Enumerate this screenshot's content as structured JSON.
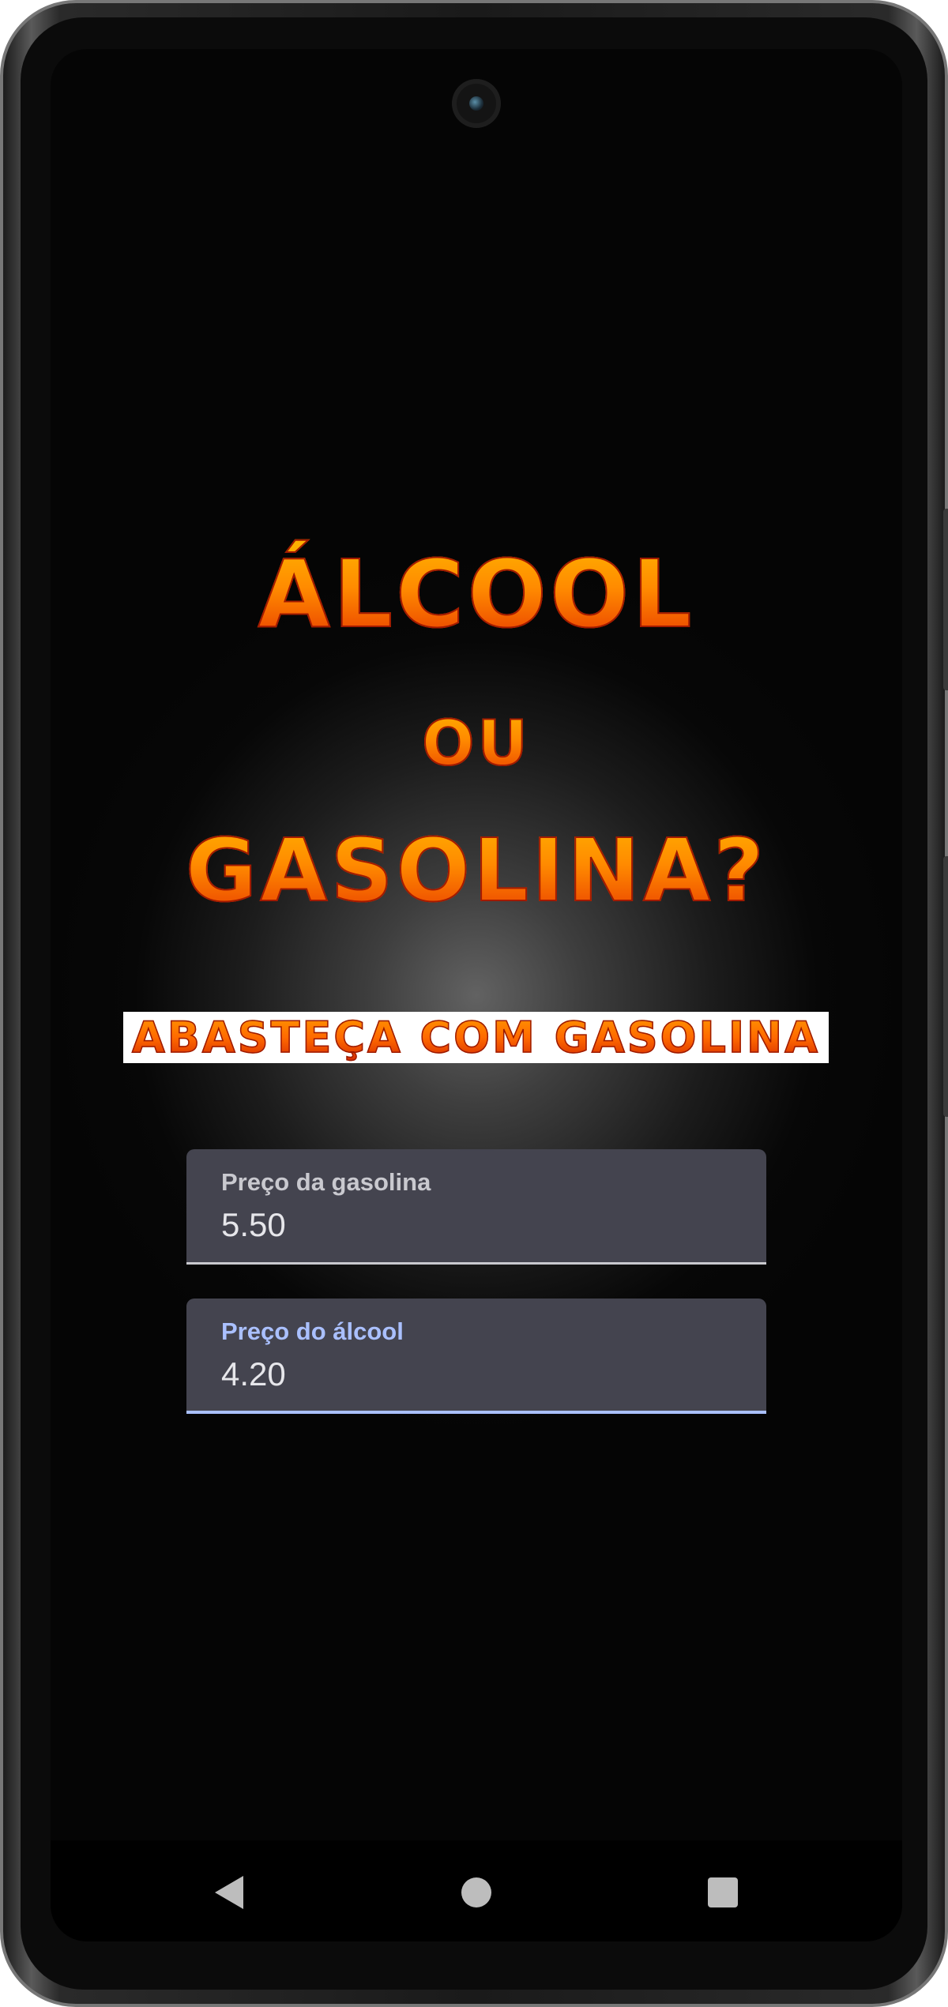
{
  "app": {
    "title_line1": "ÁLCOOL",
    "title_line2": "OU",
    "title_line3": "GASOLINA?",
    "result": "ABASTEÇA COM GASOLINA"
  },
  "fields": {
    "gasoline": {
      "label": "Preço da gasolina",
      "value": "5.50"
    },
    "alcohol": {
      "label": "Preço do álcool",
      "value": "4.20"
    }
  },
  "navbar": {
    "back_icon": "triangle-back-icon",
    "home_icon": "circle-home-icon",
    "recents_icon": "square-recents-icon"
  },
  "colors": {
    "title_top": "#ffb400",
    "title_bottom": "#e63300",
    "field_bg": "#44444f",
    "focused_accent": "#aac0ff"
  }
}
